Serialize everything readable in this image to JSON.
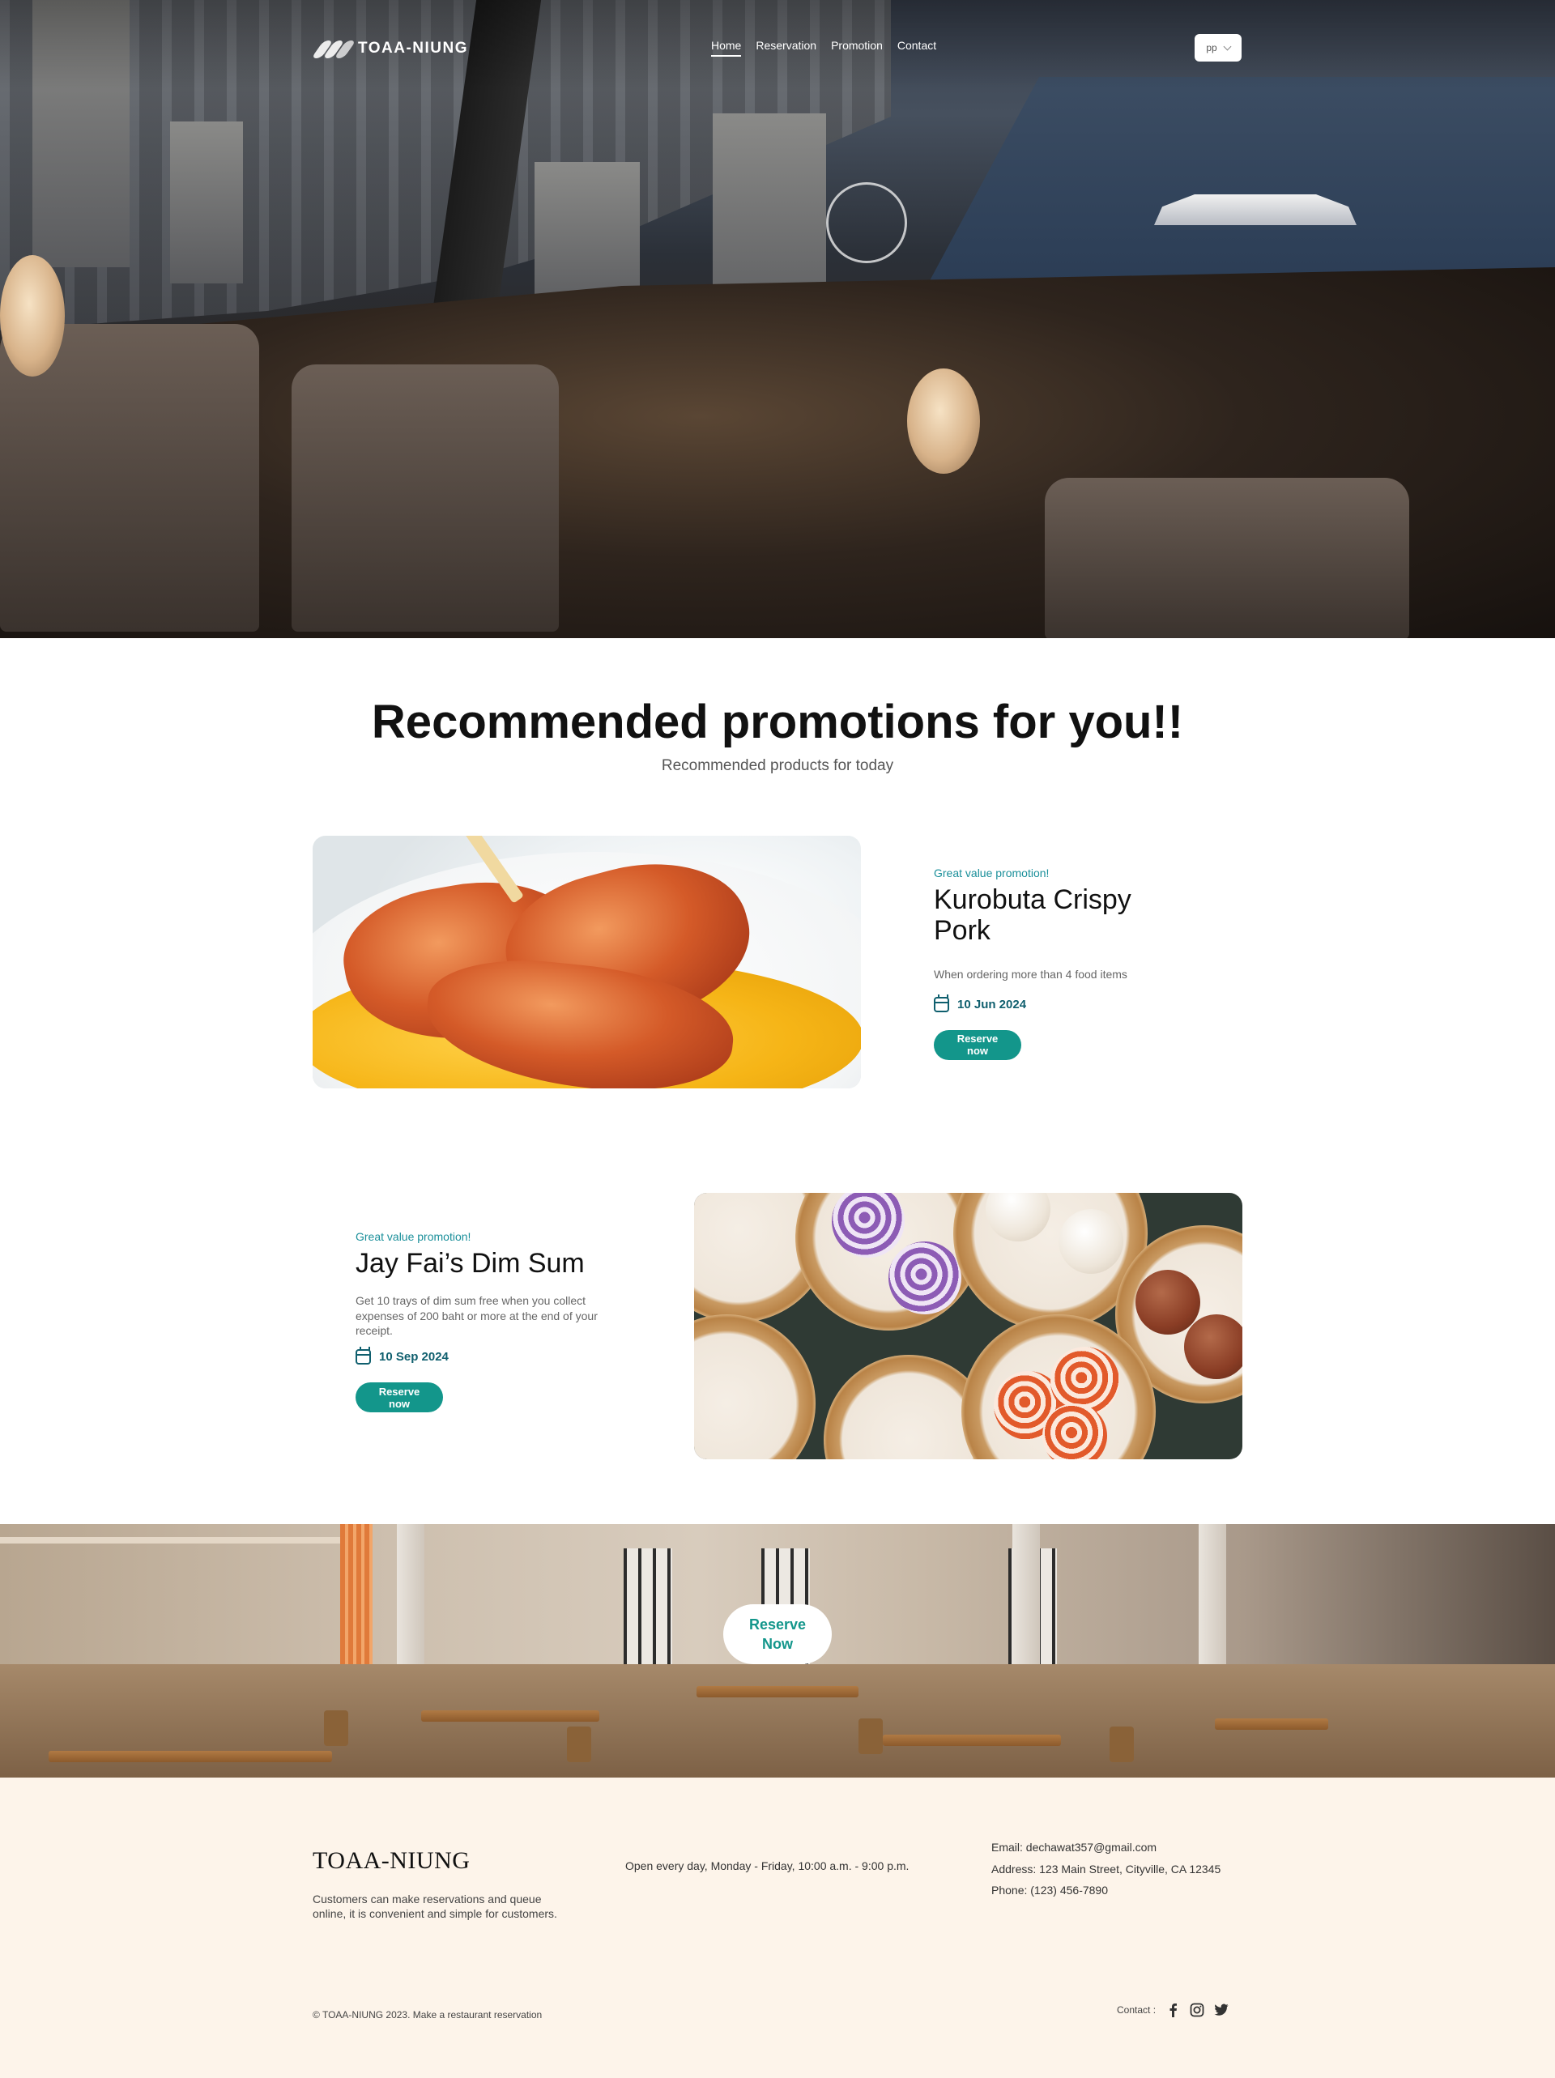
{
  "header": {
    "logo_text": "TOAA-NIUNG",
    "nav": [
      "Home",
      "Reservation",
      "Promotion",
      "Contact"
    ],
    "active_nav": "Home",
    "language": "pp"
  },
  "promotions": {
    "title": "Recommended promotions for you!!",
    "subtitle": "Recommended products for today",
    "items": [
      {
        "tag": "Great value promotion!",
        "title": "Kurobuta Crispy Pork",
        "description": "When ordering more than 4 food items",
        "date": "10 Jun 2024",
        "button": "Reserve now",
        "image": "kurobuta-crispy-pork-photo"
      },
      {
        "tag": "Great value promotion!",
        "title": "Jay Fai’s Dim Sum",
        "description": "Get 10 trays of dim sum free when you collect expenses of 200 baht or more at the end of your receipt.",
        "date": "10 Sep 2024",
        "button": "Reserve now",
        "image": "dim-sum-photo"
      }
    ]
  },
  "banner": {
    "button_line1": "Reserve",
    "button_line2": "Now"
  },
  "footer": {
    "brand": "TOAA-NIUNG",
    "about": "Customers can make reservations and queue online, it is convenient and simple for customers.",
    "hours": "Open every day, Monday - Friday, 10:00 a.m. - 9:00 p.m.",
    "email": "Email: dechawat357@gmail.com",
    "address": "Address: 123 Main Street, Cityville, CA 12345",
    "phone": "Phone: (123) 456-7890",
    "copyright": "© TOAA-NIUNG 2023. Make a restaurant reservation",
    "contact_label": "Contact :",
    "social_icons": [
      "facebook-icon",
      "instagram-icon",
      "twitter-icon"
    ]
  },
  "colors": {
    "accent": "#13968b",
    "tag": "#1a8f9a",
    "date": "#0f5f6e",
    "footer_bg": "#fdf4ea"
  }
}
